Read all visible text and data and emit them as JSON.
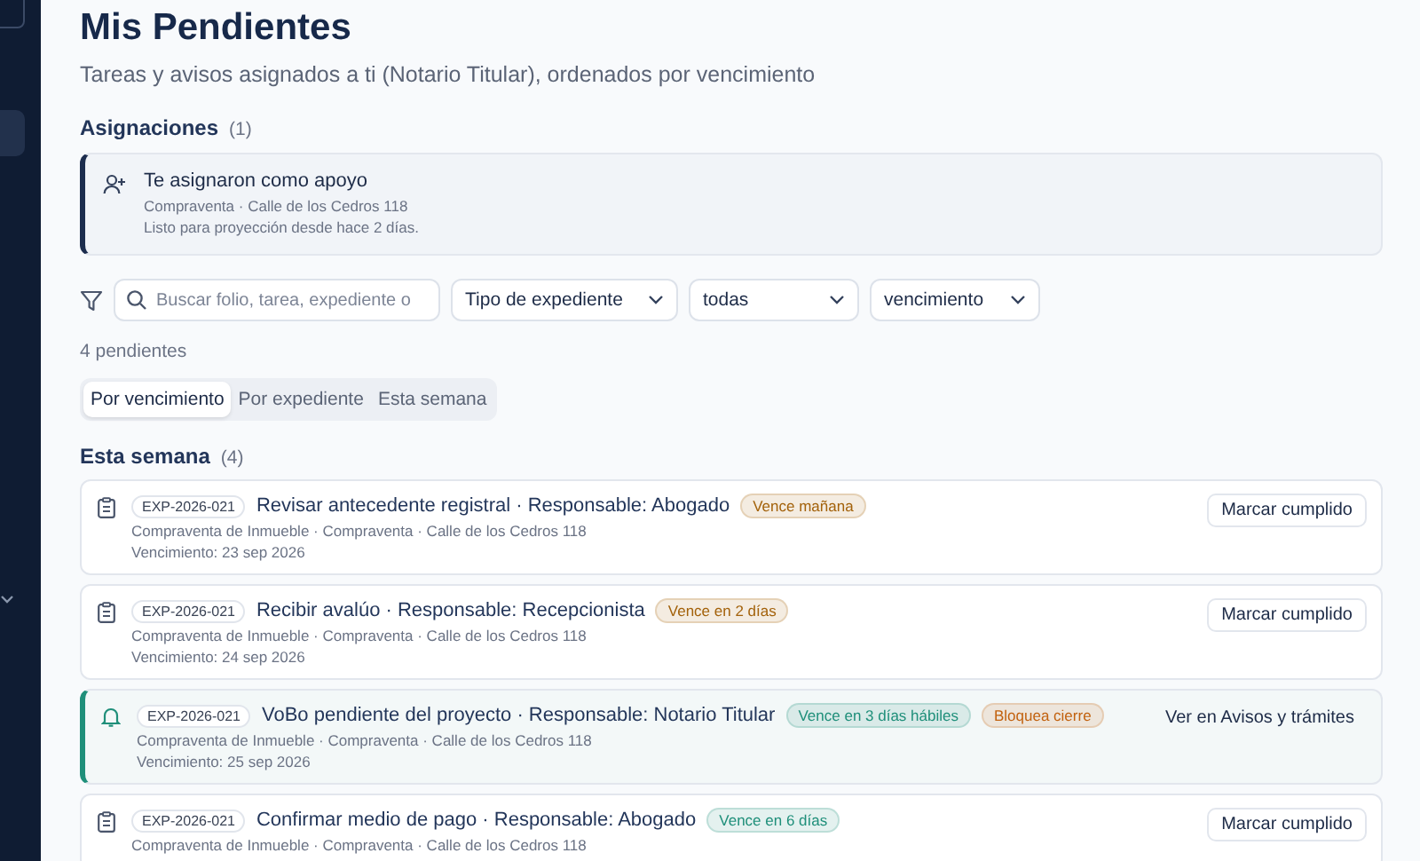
{
  "page": {
    "title": "Mis Pendientes",
    "subtitle": "Tareas y avisos asignados a ti (Notario Titular), ordenados por vencimiento"
  },
  "assignments": {
    "heading": "Asignaciones",
    "count": "(1)",
    "items": [
      {
        "title": "Te asignaron como apoyo",
        "meta": "Compraventa · Calle de los Cedros 118",
        "note": "Listo para proyección desde hace 2 días."
      }
    ]
  },
  "filters": {
    "search": {
      "placeholder": "Buscar folio, tarea, expediente o"
    },
    "selects": [
      "Tipo de expediente",
      "todas",
      "vencimiento"
    ]
  },
  "result_count": "4 pendientes",
  "view_tabs": [
    {
      "label": "Por vencimiento",
      "selected": true
    },
    {
      "label": "Por expediente",
      "selected": false
    },
    {
      "label": "Esta semana",
      "selected": false
    }
  ],
  "section": {
    "heading": "Esta semana",
    "count": "(4)",
    "items": [
      {
        "kind": "task",
        "folio": "EXP-2026-021",
        "title": "Revisar antecedente registral · Responsable: Abogado",
        "badges": [
          {
            "label": "Vence mañana",
            "color": "#a3620b"
          }
        ],
        "meta": "Compraventa de Inmueble · Compraventa · Calle de los Cedros 118",
        "due": "Vencimiento: 23 sep 2026",
        "action": "Marcar cumplido"
      },
      {
        "kind": "task",
        "folio": "EXP-2026-021",
        "title": "Recibir avalúo · Responsable: Recepcionista",
        "badges": [
          {
            "label": "Vence en 2 días",
            "color": "#a3620b"
          }
        ],
        "meta": "Compraventa de Inmueble · Compraventa · Calle de los Cedros 118",
        "due": "Vencimiento: 24 sep 2026",
        "action": "Marcar cumplido"
      },
      {
        "kind": "notice",
        "folio": "EXP-2026-021",
        "title": "VoBo pendiente del proyecto · Responsable: Notario Titular",
        "badges": [
          {
            "label": "Vence en 3 días hábiles",
            "color": "#1f8f7a"
          },
          {
            "label": "Bloquea cierre",
            "color": "#c2620f"
          }
        ],
        "meta": "Compraventa de Inmueble · Compraventa · Calle de los Cedros 118",
        "due": "Vencimiento: 25 sep 2026",
        "action": "Ver en Avisos y trámites"
      },
      {
        "kind": "task",
        "folio": "EXP-2026-021",
        "title": "Confirmar medio de pago · Responsable: Abogado",
        "badges": [
          {
            "label": "Vence en 6 días",
            "color": "#1f8f7a"
          }
        ],
        "meta": "Compraventa de Inmueble · Compraventa · Calle de los Cedros 118",
        "action": "Marcar cumplido"
      }
    ]
  }
}
